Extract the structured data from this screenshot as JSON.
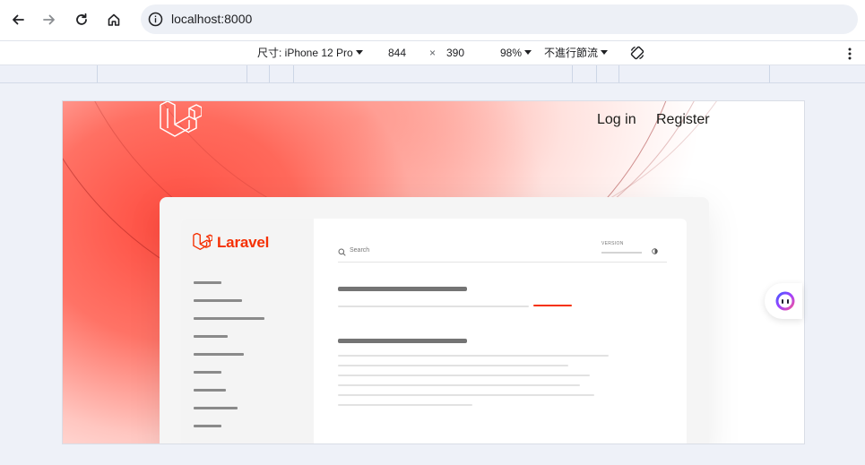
{
  "browser": {
    "url": "localhost:8000",
    "icons": {
      "back": "arrow-left-icon",
      "forward": "arrow-right-icon",
      "reload": "reload-icon",
      "home": "home-icon",
      "info": "info-icon"
    }
  },
  "device_toolbar": {
    "dimensions_label": "尺寸: iPhone 12 Pro",
    "width": "844",
    "times": "×",
    "height": "390",
    "zoom": "98%",
    "throttle": "不進行節流"
  },
  "page": {
    "login": "Log in",
    "register": "Register",
    "brand": "Laravel",
    "search_placeholder": "Search",
    "version_label": "VERSION",
    "accent": "#f53003",
    "hero_red": "#ff4433"
  }
}
